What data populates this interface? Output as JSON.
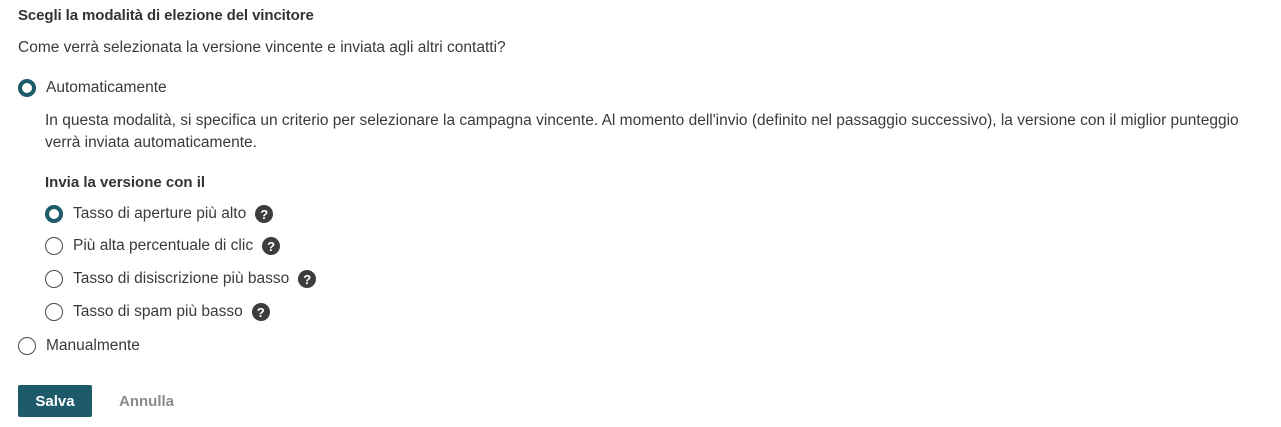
{
  "section": {
    "title": "Scegli la modalità di elezione del vincitore",
    "question": "Come verrà selezionata la versione vincente e inviata agli altri contatti?"
  },
  "modes": {
    "automatic": {
      "label": "Automaticamente",
      "selected": true,
      "description": "In questa modalità, si specifica un criterio per selezionare la campagna vincente. Al momento dell'invio (definito nel passaggio successivo), la versione con il miglior punteggio verrà inviata automaticamente."
    },
    "manual": {
      "label": "Manualmente",
      "selected": false
    }
  },
  "criteria": {
    "heading": "Invia la versione con il",
    "options": [
      {
        "label": "Tasso di aperture più alto",
        "selected": true
      },
      {
        "label": "Più alta percentuale di clic",
        "selected": false
      },
      {
        "label": "Tasso di disiscrizione più basso",
        "selected": false
      },
      {
        "label": "Tasso di spam più basso",
        "selected": false
      }
    ],
    "help_icon_glyph": "?",
    "help_icon_name": "help-icon"
  },
  "actions": {
    "save_label": "Salva",
    "cancel_label": "Annulla"
  },
  "colors": {
    "accent": "#1d5a6a",
    "text": "#3a3a3a",
    "muted": "#8a8a8a",
    "help_icon_bg": "#3d3d3d"
  }
}
